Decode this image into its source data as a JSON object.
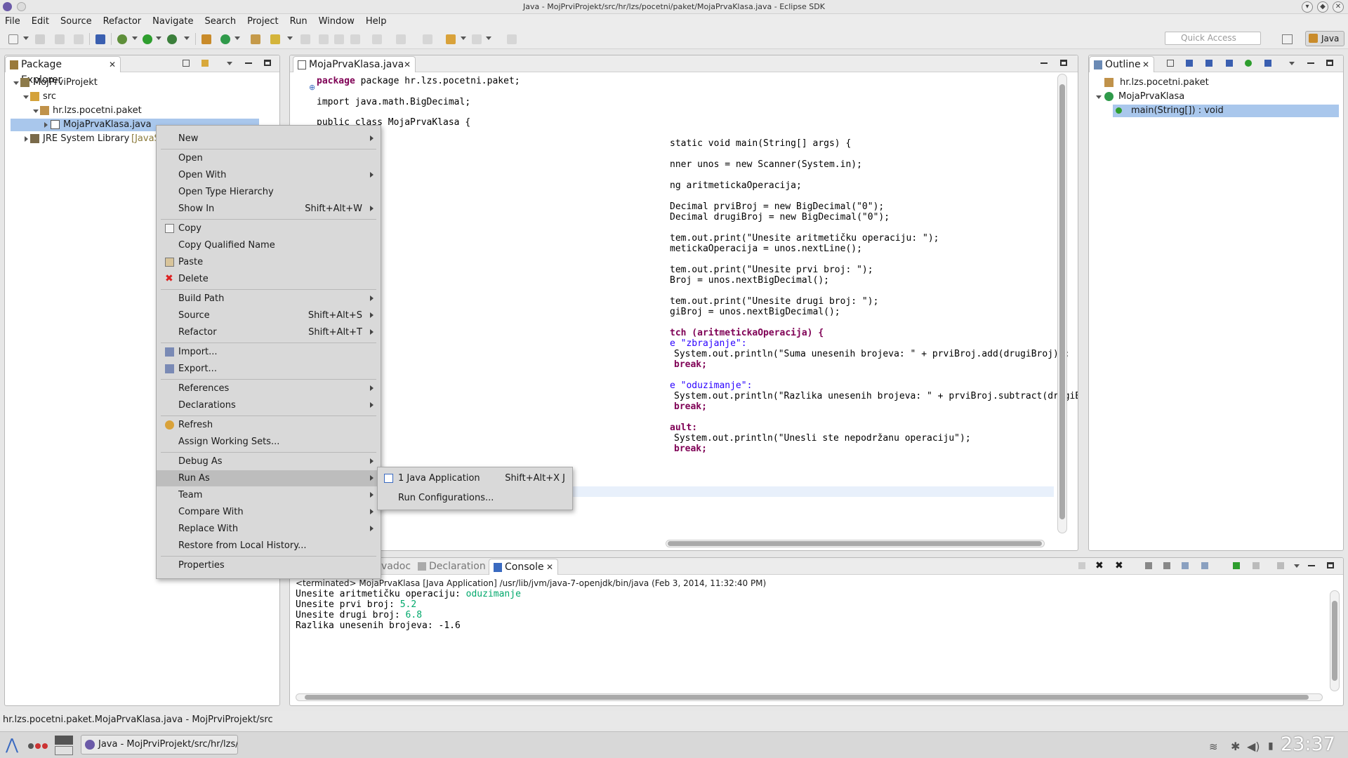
{
  "window": {
    "title": "Java - MojPrviProjekt/src/hr/lzs/pocetni/paket/MojaPrvaKlasa.java - Eclipse SDK"
  },
  "menubar": [
    "File",
    "Edit",
    "Source",
    "Refactor",
    "Navigate",
    "Search",
    "Project",
    "Run",
    "Window",
    "Help"
  ],
  "toolbar": {
    "quick_access_placeholder": "Quick Access",
    "perspective": "Java"
  },
  "package_explorer": {
    "tab_label": "Package Explorer",
    "tree": [
      {
        "label": "MojPrviProjekt"
      },
      {
        "label": "src"
      },
      {
        "label": "hr.lzs.pocetni.paket"
      },
      {
        "label": "MojaPrvaKlasa.java"
      },
      {
        "label": "JRE System Library",
        "suffix": "[JavaSE"
      }
    ]
  },
  "editor": {
    "tab_label": "MojaPrvaKlasa.java",
    "visible_code": [
      "package hr.lzs.pocetni.paket;",
      "import java.math.BigDecimal;",
      "public class MojaPrvaKlasa {",
      "static void main(String[] args) {",
      "nner unos = new Scanner(System.in);",
      "ng aritmetickaOperacija;",
      "Decimal prviBroj = new BigDecimal(\"0\");",
      "Decimal drugiBroj = new BigDecimal(\"0\");",
      "tem.out.print(\"Unesite aritmetičku operaciju: \");",
      "metickaOperacija = unos.nextLine();",
      "tem.out.print(\"Unesite prvi broj: \");",
      "Broj = unos.nextBigDecimal();",
      "tem.out.print(\"Unesite drugi broj: \");",
      "giBroj = unos.nextBigDecimal();",
      "tch (aritmetickaOperacija) {",
      "e \"zbrajanje\":",
      "System.out.println(\"Suma unesenih brojeva: \" + prviBroj.add(drugiBroj));",
      "break;",
      "e \"oduzimanje\":",
      "System.out.println(\"Razlika unesenih brojeva: \" + prviBroj.subtract(drugiBroj));",
      "break;",
      "ault:",
      "System.out.println(\"Unesli ste nepodržanu operaciju\");",
      "break;"
    ]
  },
  "outline": {
    "tab_label": "Outline",
    "items": [
      {
        "label": "hr.lzs.pocetni.paket"
      },
      {
        "label": "MojaPrvaKlasa"
      },
      {
        "label": "main(String[]) : void"
      }
    ]
  },
  "bottom_panel": {
    "tabs": [
      {
        "label": "vadoc"
      },
      {
        "label": "Declaration"
      },
      {
        "label": "Console"
      }
    ],
    "console_header": "<terminated> MojaPrvaKlasa [Java Application] /usr/lib/jvm/java-7-openjdk/bin/java (Feb 3, 2014, 11:32:40 PM)",
    "console_lines": [
      {
        "prompt": "Unesite aritmetičku operaciju: ",
        "input": "oduzimanje"
      },
      {
        "prompt": "Unesite prvi broj: ",
        "input": "5.2"
      },
      {
        "prompt": "Unesite drugi broj: ",
        "input": "6.8"
      },
      {
        "prompt": "Razlika unesenih brojeva: -1.6",
        "input": ""
      }
    ]
  },
  "context_menu": {
    "items": [
      {
        "label": "New",
        "shortcut": ""
      },
      {
        "label": "Open",
        "shortcut": ""
      },
      {
        "label": "Open With",
        "shortcut": ""
      },
      {
        "label": "Open Type Hierarchy",
        "shortcut": ""
      },
      {
        "label": "Show In",
        "shortcut": "Shift+Alt+W"
      },
      {
        "label": "Copy",
        "shortcut": ""
      },
      {
        "label": "Copy Qualified Name",
        "shortcut": ""
      },
      {
        "label": "Paste",
        "shortcut": ""
      },
      {
        "label": "Delete",
        "shortcut": ""
      },
      {
        "label": "Build Path",
        "shortcut": ""
      },
      {
        "label": "Source",
        "shortcut": "Shift+Alt+S"
      },
      {
        "label": "Refactor",
        "shortcut": "Shift+Alt+T"
      },
      {
        "label": "Import...",
        "shortcut": ""
      },
      {
        "label": "Export...",
        "shortcut": ""
      },
      {
        "label": "References",
        "shortcut": ""
      },
      {
        "label": "Declarations",
        "shortcut": ""
      },
      {
        "label": "Refresh",
        "shortcut": ""
      },
      {
        "label": "Assign Working Sets...",
        "shortcut": ""
      },
      {
        "label": "Debug As",
        "shortcut": ""
      },
      {
        "label": "Run As",
        "shortcut": ""
      },
      {
        "label": "Team",
        "shortcut": ""
      },
      {
        "label": "Compare With",
        "shortcut": ""
      },
      {
        "label": "Replace With",
        "shortcut": ""
      },
      {
        "label": "Restore from Local History...",
        "shortcut": ""
      },
      {
        "label": "Properties",
        "shortcut": ""
      }
    ]
  },
  "run_as_submenu": {
    "items": [
      {
        "label": "1 Java Application",
        "shortcut": "Shift+Alt+X J"
      },
      {
        "label": "Run Configurations...",
        "shortcut": ""
      }
    ]
  },
  "statusbar": {
    "text": "hr.lzs.pocetni.paket.MojaPrvaKlasa.java - MojPrviProjekt/src"
  },
  "taskbar": {
    "task_label": "Java - MojPrviProjekt/src/hr/lzs/p",
    "clock": "23:37"
  }
}
